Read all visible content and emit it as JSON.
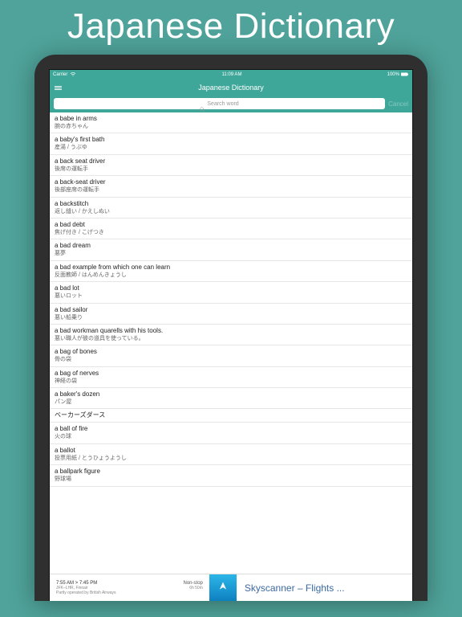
{
  "hero": {
    "title": "Japanese Dictionary"
  },
  "status_bar": {
    "carrier": "Carrier",
    "wifi_icon": "wifi-icon",
    "time": "11:09 AM",
    "battery_pct": "100%"
  },
  "nav": {
    "title": "Japanese Dictionary"
  },
  "search": {
    "placeholder": "Search word",
    "cancel": "Cancel"
  },
  "entries": [
    {
      "en": "a babe in arms",
      "jp": "腕の赤ちゃん"
    },
    {
      "en": "a baby's first bath",
      "jp": "産湯 / うぶゆ"
    },
    {
      "en": "a back seat driver",
      "jp": "後席の運転手"
    },
    {
      "en": "a back-seat driver",
      "jp": "後部座席の運転手"
    },
    {
      "en": "a backstitch",
      "jp": "返し縫い / かえしぬい"
    },
    {
      "en": "a bad debt",
      "jp": "焦げ付き / こげつき"
    },
    {
      "en": "a bad dream",
      "jp": "悪夢"
    },
    {
      "en": "a bad example from which one can learn",
      "jp": "反面教師 / はんめんきょうし"
    },
    {
      "en": "a bad lot",
      "jp": "悪いロット"
    },
    {
      "en": "a bad sailor",
      "jp": "悪い船乗り"
    },
    {
      "en": "a bad workman quarells with his tools.",
      "jp": "悪い職人が彼の道具を使っている。"
    },
    {
      "en": "a bag of bones",
      "jp": "骨の袋"
    },
    {
      "en": "a bag of nerves",
      "jp": "神経の袋"
    },
    {
      "en": "a baker's dozen",
      "jp": "パン屋"
    },
    {
      "en": "",
      "jp": "ベーカーズダース"
    },
    {
      "en": "a ball of fire",
      "jp": "火の球"
    },
    {
      "en": "a ballot",
      "jp": "投票用紙 / とうひょうようし"
    },
    {
      "en": "a ballpark figure",
      "jp": "野球場"
    }
  ],
  "ad": {
    "times": "7:55 AM > 7:45 PM",
    "route": "JFK–LHR, Finnair",
    "operated": "Partly operated by British Airways",
    "nonstop": "Non-stop",
    "duration": "6h 50m",
    "title": "Skyscanner – Flights ..."
  }
}
